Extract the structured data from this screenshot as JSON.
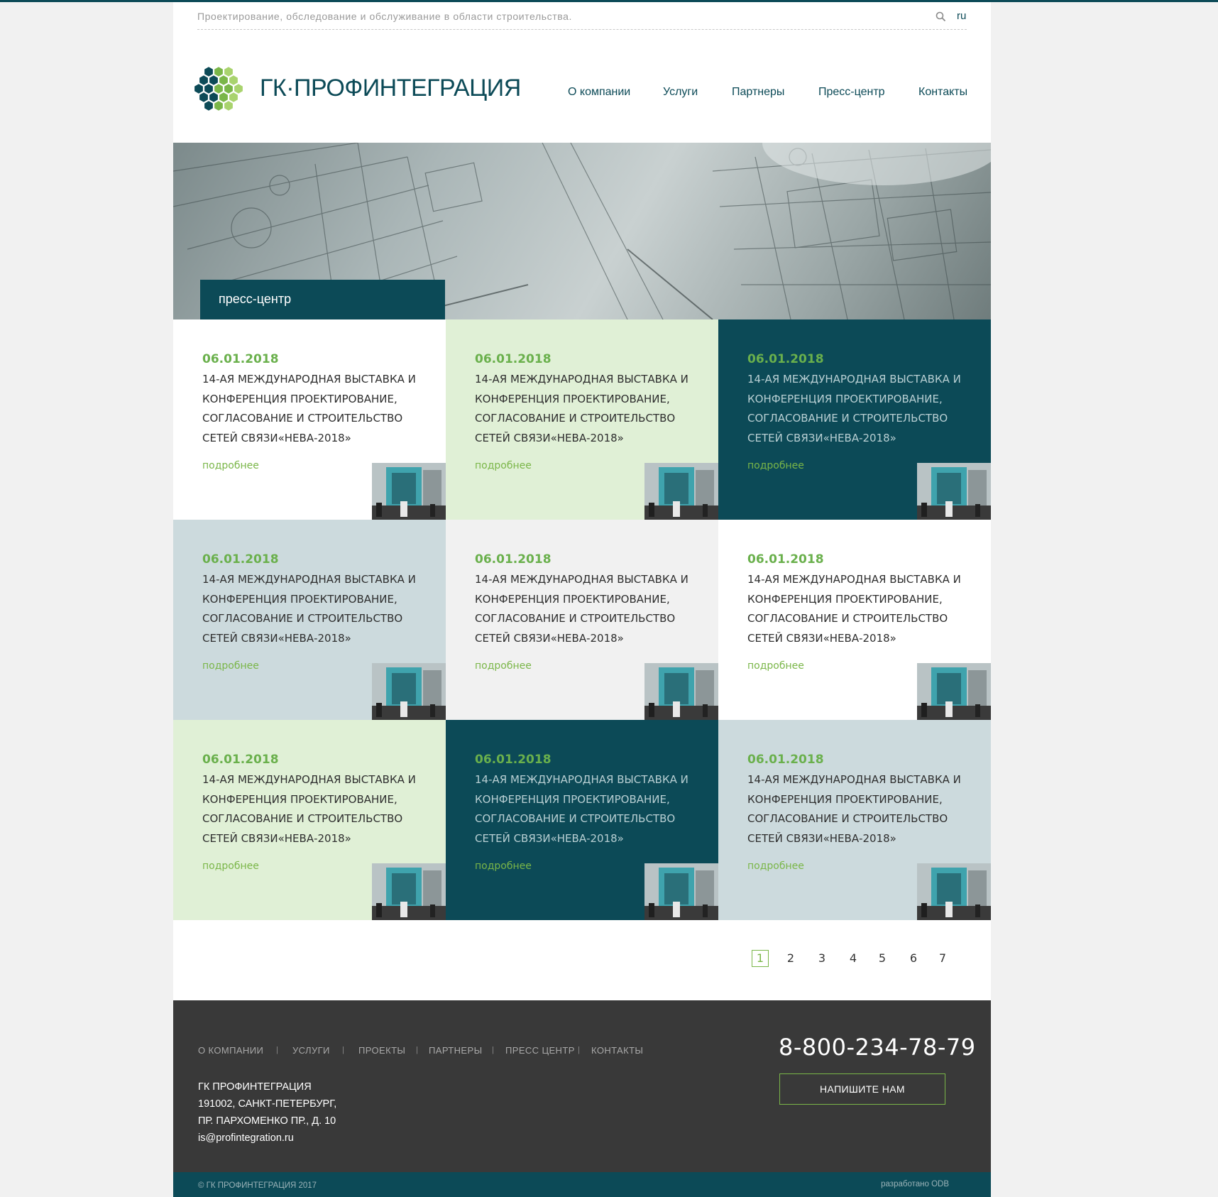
{
  "topbar": {
    "tagline": "Проектирование, обследование и обслуживание в области строительства.",
    "search_icon": "search-icon",
    "lang": "ru"
  },
  "header": {
    "logo_text": "ГК·ПРОФИНТЕГРАЦИЯ",
    "nav": [
      "О компании",
      "Услуги",
      "Партнеры",
      "Пресс-центр",
      "Контакты"
    ]
  },
  "hero": {
    "label": "пресс-центр"
  },
  "news": [
    {
      "date": "06.01.2018",
      "title": "14-АЯ МЕЖДУНАРОДНАЯ ВЫСТАВКА И КОНФЕРЕНЦИЯ ПРОЕКТИРОВАНИЕ, СОГЛАСОВАНИЕ И СТРОИТЕЛЬСТВО СЕТЕЙ СВЯЗИ«НЕВА-2018»",
      "more": "подробнее"
    },
    {
      "date": "06.01.2018",
      "title": "14-АЯ МЕЖДУНАРОДНАЯ ВЫСТАВКА И КОНФЕРЕНЦИЯ ПРОЕКТИРОВАНИЕ, СОГЛАСОВАНИЕ И СТРОИТЕЛЬСТВО СЕТЕЙ СВЯЗИ«НЕВА-2018»",
      "more": "подробнее"
    },
    {
      "date": "06.01.2018",
      "title": "14-АЯ МЕЖДУНАРОДНАЯ ВЫСТАВКА И КОНФЕРЕНЦИЯ ПРОЕКТИРОВАНИЕ, СОГЛАСОВАНИЕ И СТРОИТЕЛЬСТВО СЕТЕЙ СВЯЗИ«НЕВА-2018»",
      "more": "подробнее"
    },
    {
      "date": "06.01.2018",
      "title": "14-АЯ МЕЖДУНАРОДНАЯ ВЫСТАВКА И КОНФЕРЕНЦИЯ ПРОЕКТИРОВАНИЕ, СОГЛАСОВАНИЕ И СТРОИТЕЛЬСТВО СЕТЕЙ СВЯЗИ«НЕВА-2018»",
      "more": "подробнее"
    },
    {
      "date": "06.01.2018",
      "title": "14-АЯ МЕЖДУНАРОДНАЯ ВЫСТАВКА И КОНФЕРЕНЦИЯ ПРОЕКТИРОВАНИЕ, СОГЛАСОВАНИЕ И СТРОИТЕЛЬСТВО СЕТЕЙ СВЯЗИ«НЕВА-2018»",
      "more": "подробнее"
    },
    {
      "date": "06.01.2018",
      "title": "14-АЯ МЕЖДУНАРОДНАЯ ВЫСТАВКА И КОНФЕРЕНЦИЯ ПРОЕКТИРОВАНИЕ, СОГЛАСОВАНИЕ И СТРОИТЕЛЬСТВО СЕТЕЙ СВЯЗИ«НЕВА-2018»",
      "more": "подробнее"
    },
    {
      "date": "06.01.2018",
      "title": "14-АЯ МЕЖДУНАРОДНАЯ ВЫСТАВКА И КОНФЕРЕНЦИЯ ПРОЕКТИРОВАНИЕ, СОГЛАСОВАНИЕ И СТРОИТЕЛЬСТВО СЕТЕЙ СВЯЗИ«НЕВА-2018»",
      "more": "подробнее"
    },
    {
      "date": "06.01.2018",
      "title": "14-АЯ МЕЖДУНАРОДНАЯ ВЫСТАВКА И КОНФЕРЕНЦИЯ ПРОЕКТИРОВАНИЕ, СОГЛАСОВАНИЕ И СТРОИТЕЛЬСТВО СЕТЕЙ СВЯЗИ«НЕВА-2018»",
      "more": "подробнее"
    },
    {
      "date": "06.01.2018",
      "title": "14-АЯ МЕЖДУНАРОДНАЯ ВЫСТАВКА И КОНФЕРЕНЦИЯ ПРОЕКТИРОВАНИЕ, СОГЛАСОВАНИЕ И СТРОИТЕЛЬСТВО СЕТЕЙ СВЯЗИ«НЕВА-2018»",
      "more": "подробнее"
    }
  ],
  "pagination": {
    "pages": [
      "1",
      "2",
      "3",
      "4",
      "5",
      "6",
      "7"
    ],
    "current": "1"
  },
  "footer": {
    "nav": [
      "О КОМПАНИИ",
      "УСЛУГИ",
      "ПРОЕКТЫ",
      "ПАРТНЕРЫ",
      "ПРЕСС ЦЕНТР",
      "КОНТАКТЫ"
    ],
    "separator": "|",
    "address": [
      "ГК ПРОФИНТЕГРАЦИЯ",
      "191002, САНКТ-ПЕТЕРБУРГ,",
      "ПР. ПАРХОМЕНКО ПР., Д. 10",
      "is@profintegration.ru"
    ],
    "phone": "8-800-234-78-79",
    "write_us": "НАПИШИТЕ НАМ",
    "copyright": "© ГК ПРОФИНТЕГРАЦИЯ 2017",
    "developer": "разработано ODB"
  },
  "colors": {
    "accent_dark": "#0c4a57",
    "accent_green": "#7ab648",
    "date_green": "#6ab04c",
    "card_light_green": "#e0f0d6",
    "card_gray_blue": "#ccdadd",
    "card_light_gray": "#f1f1f1",
    "footer_bg": "#393939"
  }
}
